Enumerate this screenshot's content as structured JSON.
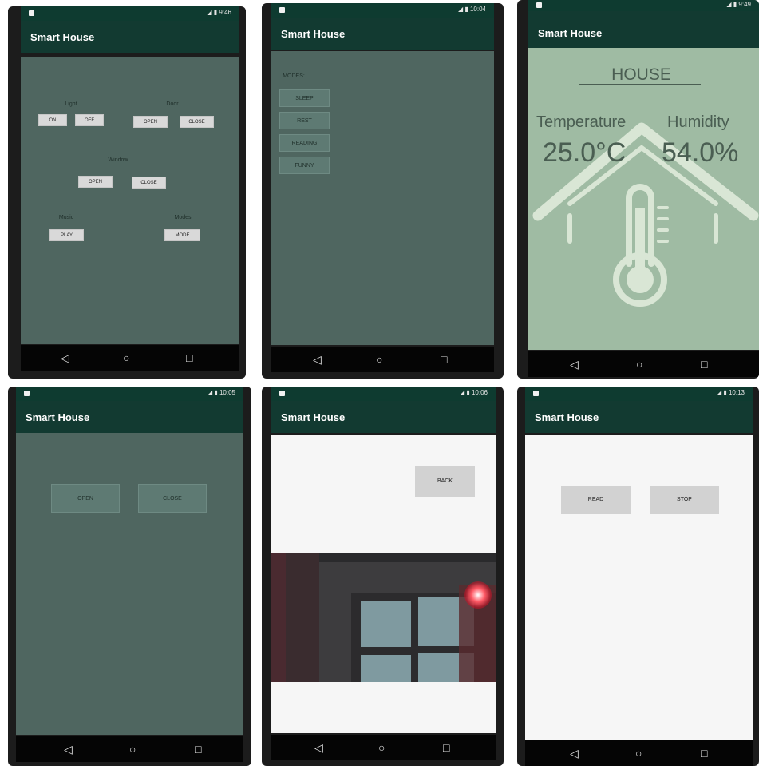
{
  "app_title": "Smart House",
  "nav": {
    "back": "◁",
    "home": "○",
    "recent": "□"
  },
  "screens": [
    {
      "time": "9:46",
      "groups": {
        "light": {
          "label": "Light",
          "on": "ON",
          "off": "OFF"
        },
        "door": {
          "label": "Door",
          "open": "OPEN",
          "close": "CLOSE"
        },
        "window": {
          "label": "Window",
          "open": "OPEN",
          "close": "CLOSE"
        },
        "music": {
          "label": "Music",
          "play": "PLAY"
        },
        "modes": {
          "label": "Modes",
          "mode": "MODE"
        }
      }
    },
    {
      "time": "10:04",
      "modes_label": "MODES:",
      "modes": [
        "SLEEP",
        "REST",
        "READING",
        "FUNNY"
      ]
    },
    {
      "time": "9:49",
      "house": "HOUSE",
      "temperature_label": "Temperature",
      "humidity_label": "Humidity",
      "temperature": "25.0°C",
      "humidity": "54.0%"
    },
    {
      "time": "10:05",
      "open": "OPEN",
      "close": "CLOSE"
    },
    {
      "time": "10:06",
      "back": "BACK"
    },
    {
      "time": "10:13",
      "read": "READ",
      "stop": "STOP"
    }
  ],
  "colors": {
    "status_bar": "#0e3b30",
    "app_bar": "#123a31",
    "content_dark": "#4f6660",
    "content_light": "#9fbba3",
    "content_white": "#f6f6f6",
    "icon_color": "#d9e6d5"
  }
}
